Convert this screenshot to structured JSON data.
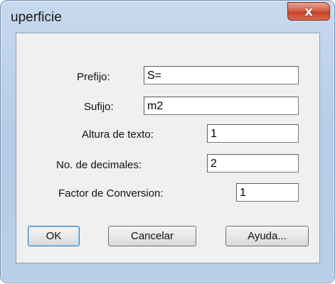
{
  "window": {
    "title": "uperficie",
    "close_glyph": "x"
  },
  "form": {
    "prefijo": {
      "label": "Prefijo:",
      "value": "S="
    },
    "sufijo": {
      "label": "Sufijo:",
      "value": "m2"
    },
    "altura": {
      "label": "Altura de texto:",
      "value": "1"
    },
    "decimales": {
      "label": "No. de decimales:",
      "value": "2"
    },
    "factor": {
      "label": "Factor de Conversion:",
      "value": "1"
    }
  },
  "buttons": {
    "ok": "OK",
    "cancelar": "Cancelar",
    "ayuda": "Ayuda..."
  },
  "colors": {
    "frame": "#b8cde6",
    "client": "#f0f0f0",
    "close": "#c7432a"
  }
}
